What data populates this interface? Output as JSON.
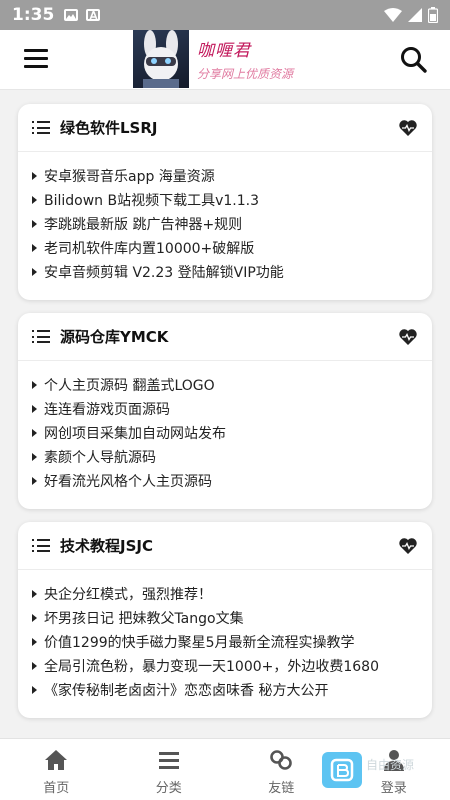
{
  "status_bar": {
    "time": "1:35",
    "left_icons": [
      "image-icon",
      "a-icon"
    ],
    "right_icons": [
      "wifi-icon",
      "signal-icon",
      "battery-icon"
    ]
  },
  "header": {
    "logo_title": "咖喱君",
    "logo_subtitle": "分享网上优质资源",
    "menu_icon": "menu-icon",
    "search_icon": "search-icon"
  },
  "sections": [
    {
      "title": "绿色软件LSRJ",
      "items": [
        "安卓猴哥音乐app 海量资源",
        "Bilidown B站视频下载工具v1.1.3",
        "李跳跳最新版 跳广告神器+规则",
        "老司机软件库内置10000+破解版",
        "安卓音频剪辑 V2.23 登陆解锁VIP功能"
      ]
    },
    {
      "title": "源码仓库YMCK",
      "items": [
        "个人主页源码 翻盖式LOGO",
        "连连看游戏页面源码",
        "网创项目采集加自动网站发布",
        "素颜个人导航源码",
        "好看流光风格个人主页源码"
      ]
    },
    {
      "title": "技术教程JSJC",
      "items": [
        "央企分红模式，强烈推荐！",
        "坏男孩日记 把妹教父Tango文集",
        "价值1299的快手磁力聚星5月最新全流程实操教学",
        "全局引流色粉，暴力变现一天1000+，外边收费1680",
        "《家传秘制老卤卤汁》恋恋卤味香 秘方大公开"
      ]
    }
  ],
  "bottom_nav": [
    {
      "label": "首页",
      "icon": "home-icon"
    },
    {
      "label": "分类",
      "icon": "category-icon"
    },
    {
      "label": "友链",
      "icon": "link-icon"
    },
    {
      "label": "登录",
      "icon": "user-icon"
    }
  ],
  "watermark": {
    "text": "自由资源"
  },
  "colors": {
    "status_bar": "#9e9e9e",
    "accent_logo": "#c2185b",
    "watermark": "#35b6f0"
  }
}
